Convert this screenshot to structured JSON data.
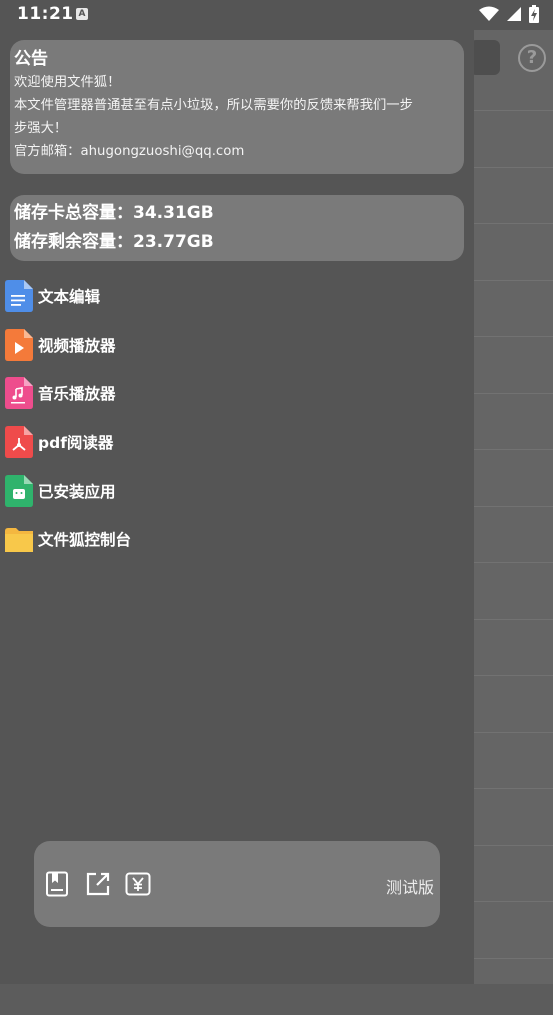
{
  "status_bar": {
    "time": "11:21",
    "notification_badge": "A",
    "icons": [
      "wifi-icon",
      "signal-icon",
      "battery-icon"
    ]
  },
  "notice": {
    "title": "公告",
    "lines": [
      "欢迎使用文件狐！",
      "本文件管理器普通甚至有点小垃圾，所以需要你的反馈来帮我们一步",
      "步强大！",
      "官方邮箱：ahugongzuoshi@qq.com"
    ]
  },
  "storage": {
    "total": "储存卡总容量：34.31GB",
    "free": "储存剩余容量：23.77GB"
  },
  "menu": {
    "items": [
      {
        "label": "文本编辑",
        "icon": "text-file-icon",
        "color": "#4f8ee8"
      },
      {
        "label": "视频播放器",
        "icon": "video-file-icon",
        "color": "#f47a3a"
      },
      {
        "label": "音乐播放器",
        "icon": "music-file-icon",
        "color": "#ee4d8d"
      },
      {
        "label": "pdf阅读器",
        "icon": "pdf-file-icon",
        "color": "#ef4b4b"
      },
      {
        "label": "已安装应用",
        "icon": "apk-file-icon",
        "color": "#2fb36c"
      },
      {
        "label": "文件狐控制台",
        "icon": "folder-icon",
        "color": "#f8c84a"
      }
    ]
  },
  "bottom_bar": {
    "icons": [
      "book-icon",
      "share-icon",
      "yen-icon"
    ],
    "version_label": "测试版"
  }
}
